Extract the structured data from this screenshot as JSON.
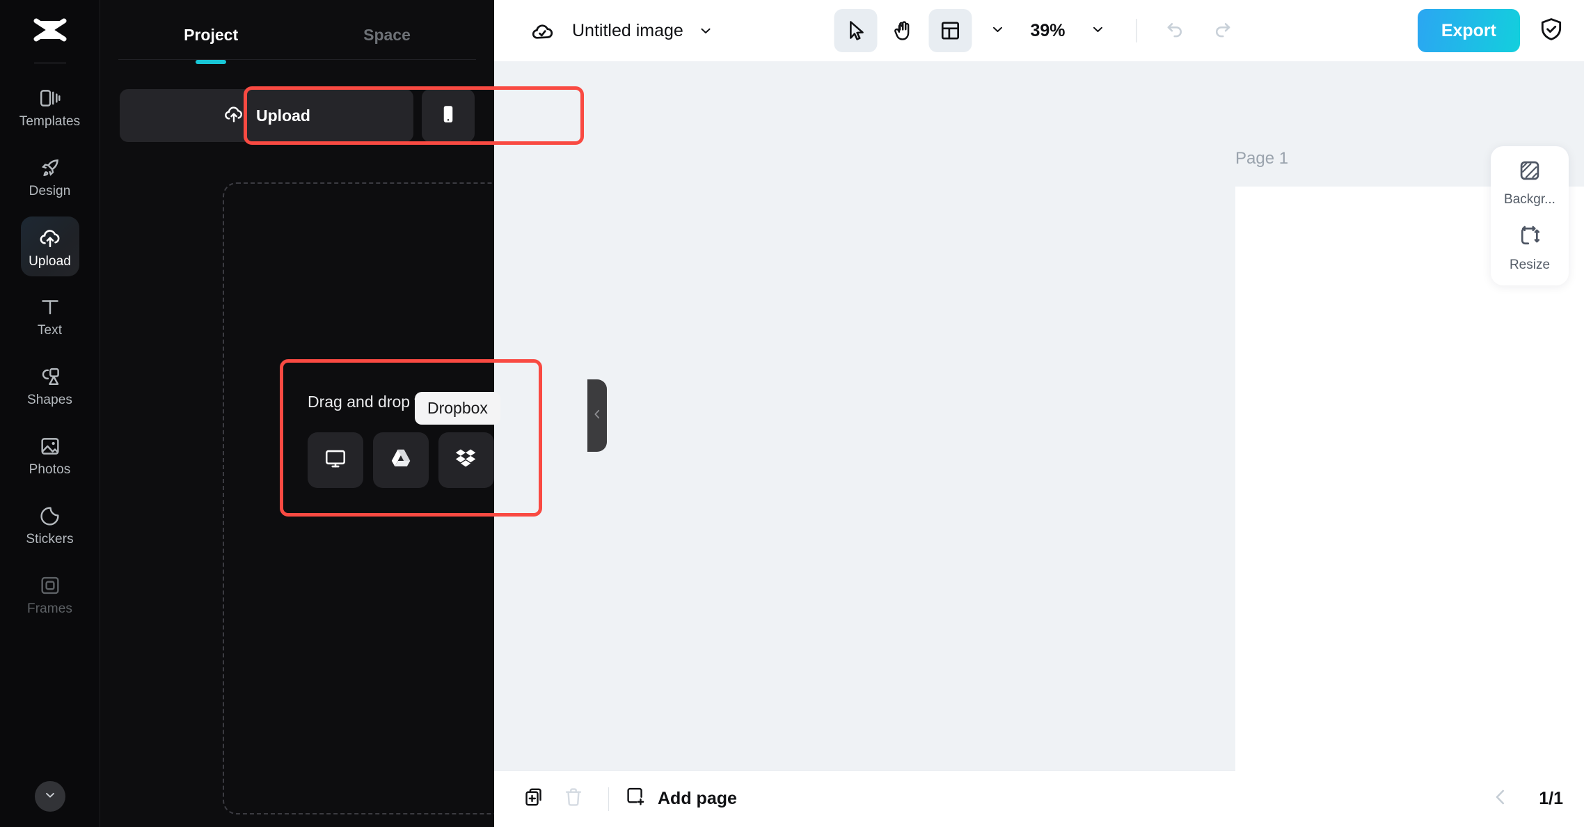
{
  "app": {
    "logo_icon": "capcut-logo-icon"
  },
  "rail": {
    "items": [
      {
        "label": "Templates",
        "icon": "templates-icon",
        "active": false
      },
      {
        "label": "Design",
        "icon": "design-rocket-icon",
        "active": false
      },
      {
        "label": "Upload",
        "icon": "upload-cloud-icon",
        "active": true
      },
      {
        "label": "Text",
        "icon": "text-t-icon",
        "active": false
      },
      {
        "label": "Shapes",
        "icon": "shapes-icon",
        "active": false
      },
      {
        "label": "Photos",
        "icon": "photos-image-icon",
        "active": false
      },
      {
        "label": "Stickers",
        "icon": "sticker-icon",
        "active": false
      },
      {
        "label": "Frames",
        "icon": "frames-icon",
        "active": false
      }
    ],
    "expand_icon": "chevron-down-icon"
  },
  "panel": {
    "tabs": [
      {
        "label": "Project",
        "active": true
      },
      {
        "label": "Space",
        "active": false
      }
    ],
    "upload_label": "Upload",
    "upload_icon": "upload-cloud-icon",
    "phone_icon": "mobile-phone-icon",
    "dropzone_text": "Drag and drop file here",
    "sources": [
      {
        "name": "this-device",
        "icon": "monitor-icon"
      },
      {
        "name": "google-drive",
        "icon": "google-drive-icon"
      },
      {
        "name": "dropbox",
        "icon": "dropbox-icon"
      }
    ],
    "tooltip": "Dropbox",
    "collapse_icon": "chevron-left-icon",
    "highlight_color": "#f94a42"
  },
  "topbar": {
    "cloud_icon": "cloud-saved-icon",
    "doc_title": "Untitled image",
    "title_caret_icon": "chevron-down-icon",
    "tools": [
      {
        "name": "select-tool",
        "icon": "cursor-arrow-icon",
        "selected": true
      },
      {
        "name": "hand-tool",
        "icon": "hand-icon",
        "selected": false
      },
      {
        "name": "layout-tool",
        "icon": "layout-panel-icon",
        "selected": true
      }
    ],
    "layout_caret_icon": "chevron-down-icon",
    "zoom_value": "39%",
    "zoom_caret_icon": "chevron-down-icon",
    "undo_icon": "undo-arrow-icon",
    "redo_icon": "redo-arrow-icon",
    "export_label": "Export",
    "export_gradient_from": "#2ba6f2",
    "export_gradient_to": "#13cfdd",
    "shield_icon": "shield-check-icon"
  },
  "canvas": {
    "page_label": "Page 1",
    "duplicate_page_icon": "duplicate-image-icon",
    "more_icon": "more-dots-icon",
    "artboard_color": "#ffffff",
    "background_color": "#eff2f5"
  },
  "dock": {
    "items": [
      {
        "label": "Backgr...",
        "icon": "background-hatch-icon"
      },
      {
        "label": "Resize",
        "icon": "resize-arrows-icon"
      }
    ]
  },
  "bottombar": {
    "duplicate_icon": "duplicate-plus-icon",
    "delete_icon": "trash-icon",
    "add_page_label": "Add page",
    "add_page_icon": "add-page-icon",
    "prev_icon": "chevron-left-icon",
    "page_count": "1/1"
  }
}
